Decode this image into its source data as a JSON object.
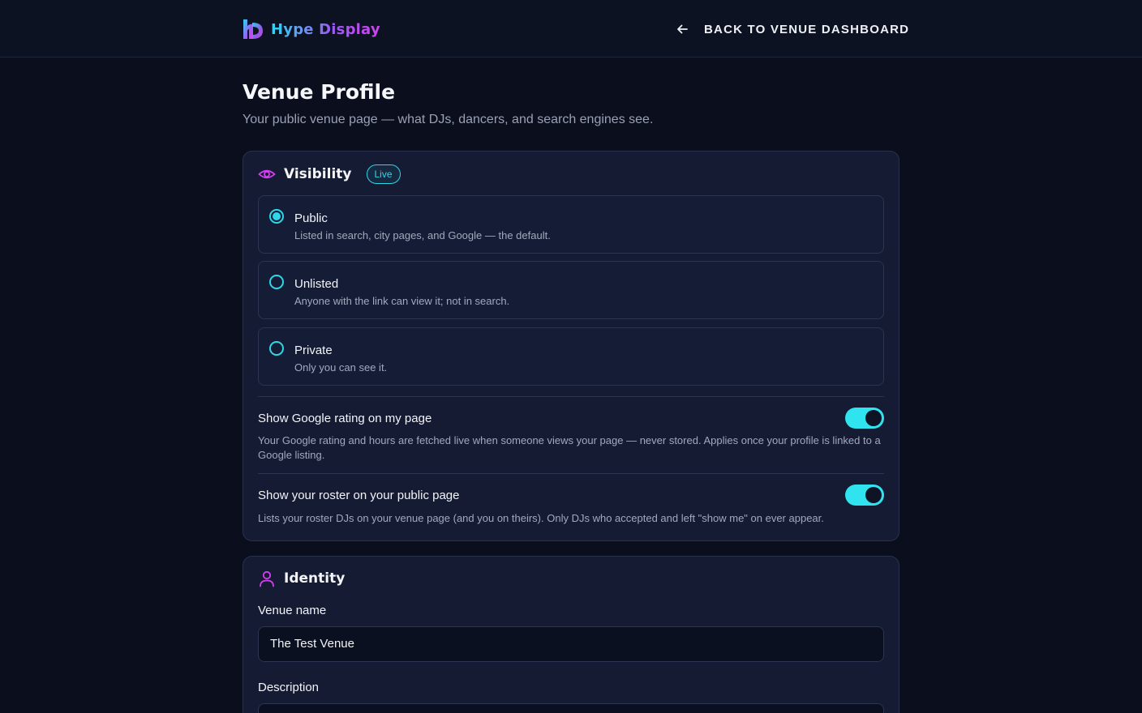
{
  "header": {
    "logo_text": "Hype Display",
    "back_label": "BACK TO VENUE DASHBOARD"
  },
  "page": {
    "title": "Venue Profile",
    "subtitle": "Your public venue page — what DJs, dancers, and search engines see."
  },
  "visibility": {
    "title": "Visibility",
    "badge": "Live",
    "options": [
      {
        "label": "Public",
        "description": "Listed in search, city pages, and Google — the default.",
        "selected": true
      },
      {
        "label": "Unlisted",
        "description": "Anyone with the link can view it; not in search.",
        "selected": false
      },
      {
        "label": "Private",
        "description": "Only you can see it.",
        "selected": false
      }
    ],
    "google_rating": {
      "title": "Show Google rating on my page",
      "description": "Your Google rating and hours are fetched live when someone views your page — never stored. Applies once your profile is linked to a Google listing.",
      "enabled": true
    },
    "roster": {
      "title": "Show your roster on your public page",
      "description": "Lists your roster DJs on your venue page (and you on theirs). Only DJs who accepted and left \"show me\" on ever appear.",
      "enabled": true
    }
  },
  "identity": {
    "title": "Identity",
    "venue_name_label": "Venue name",
    "venue_name_value": "The Test Venue",
    "description_label": "Description"
  },
  "colors": {
    "accent_cyan": "#2fd6e8",
    "accent_magenta": "#d43ff0",
    "background": "#0b0f1d",
    "card": "#141b33"
  },
  "icons": {
    "logo": "hype-display-logo",
    "back": "arrow-left-icon",
    "visibility": "eye-icon",
    "identity": "user-icon"
  }
}
